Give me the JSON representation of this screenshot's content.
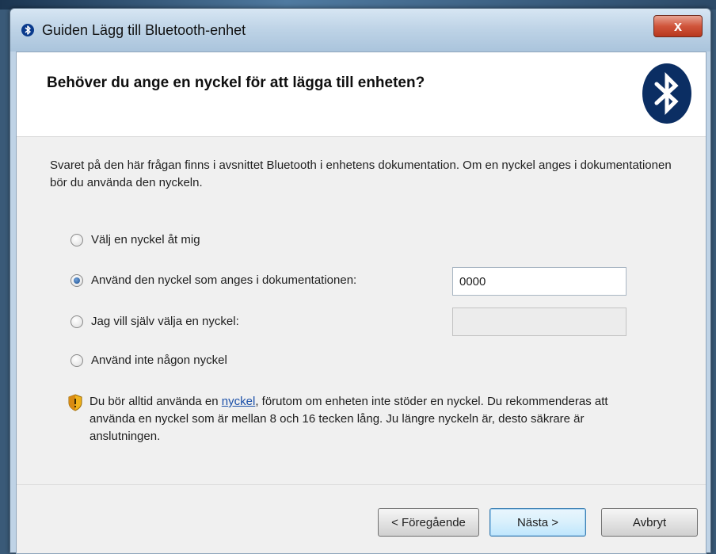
{
  "window": {
    "title": "Guiden Lägg till Bluetooth-enhet",
    "close_glyph": "x"
  },
  "header": {
    "heading": "Behöver du ange en nyckel för att lägga till enheten?",
    "logo_icon": "bluetooth-icon"
  },
  "content": {
    "description": "Svaret på den här frågan finns i avsnittet Bluetooth i enhetens dokumentation. Om en nyckel anges i dokumentationen bör du använda den nyckeln.",
    "options": [
      {
        "label": "Välj en nyckel åt mig",
        "checked": false
      },
      {
        "label": "Använd den nyckel som anges i dokumentationen:",
        "checked": true,
        "field_value": "0000"
      },
      {
        "label": "Jag vill själv välja en nyckel:",
        "checked": false,
        "field_value": "",
        "field_disabled": true
      },
      {
        "label": "Använd inte någon nyckel",
        "checked": false
      }
    ],
    "notice": {
      "icon": "shield-warning-icon",
      "prefix": "Du bör alltid använda en ",
      "link": "nyckel",
      "suffix": ", förutom om enheten inte stöder en nyckel. Du rekommenderas att använda en nyckel som är mellan 8 och 16 tecken lång. Ju längre nyckeln är, desto säkrare är anslutningen."
    }
  },
  "footer": {
    "back_label": "< Föregående",
    "next_label": "Nästa >",
    "cancel_label": "Avbryt"
  },
  "colors": {
    "titlebar": "#bfd4e7",
    "close_button": "#d0553b",
    "bluetooth_logo": "#0b2e63",
    "link": "#1a4fa8"
  }
}
